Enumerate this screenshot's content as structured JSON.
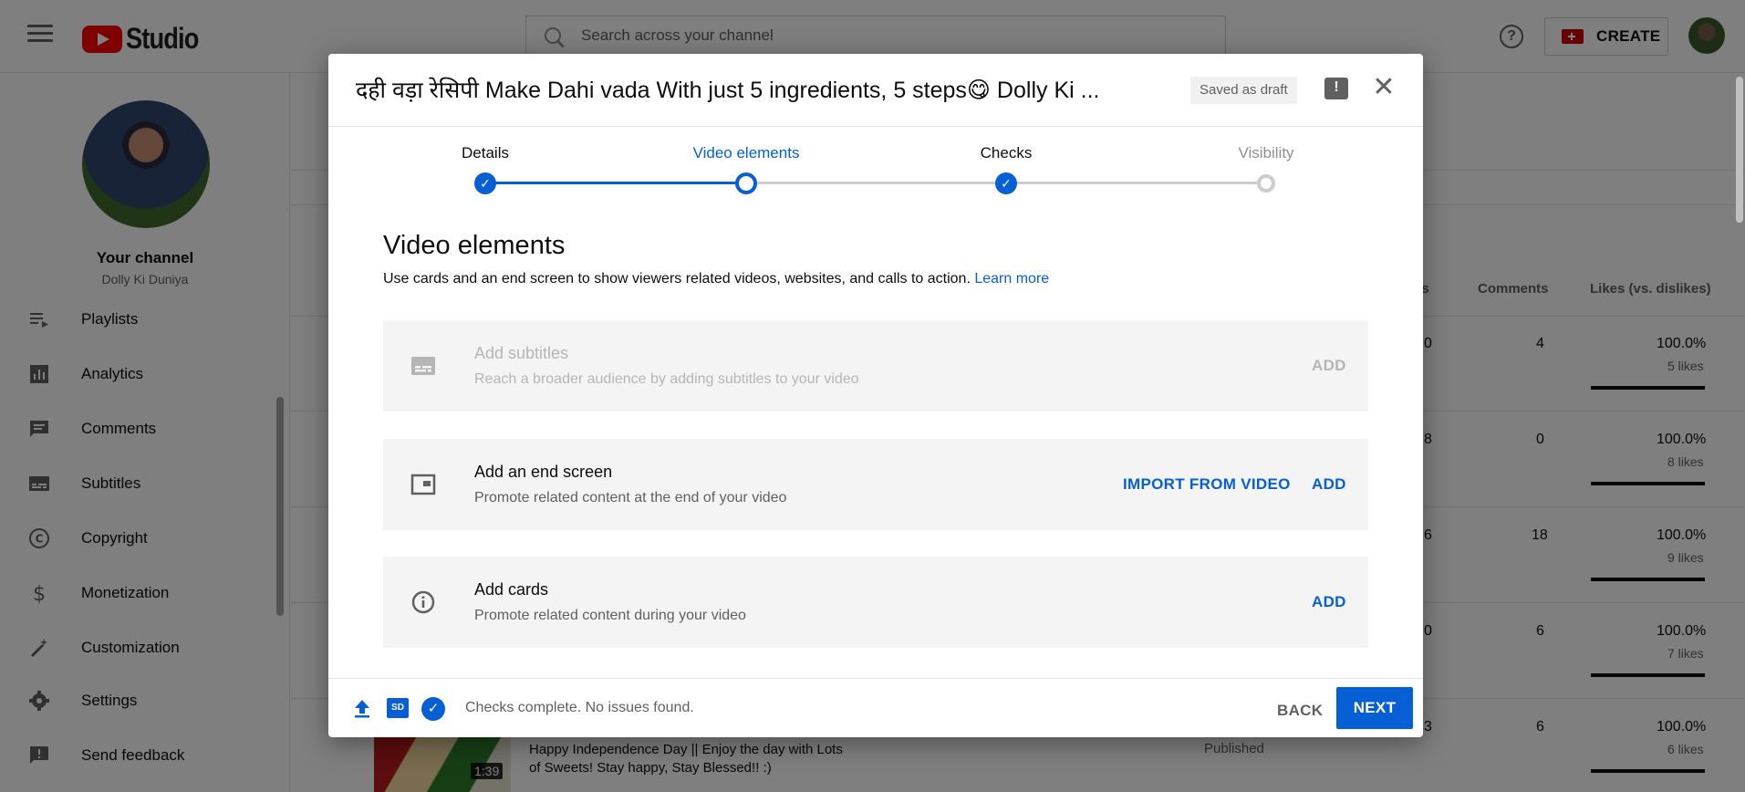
{
  "app": {
    "title": "Studio"
  },
  "search": {
    "placeholder": "Search across your channel"
  },
  "header": {
    "create_label": "CREATE"
  },
  "sidebar": {
    "your_channel": "Your channel",
    "channel_name": "Dolly Ki Duniya",
    "items": [
      {
        "label": "Playlists",
        "icon": "playlists-icon"
      },
      {
        "label": "Analytics",
        "icon": "analytics-icon"
      },
      {
        "label": "Comments",
        "icon": "comments-icon"
      },
      {
        "label": "Subtitles",
        "icon": "subtitles-icon"
      },
      {
        "label": "Copyright",
        "icon": "copyright-icon"
      },
      {
        "label": "Monetization",
        "icon": "monetization-icon"
      },
      {
        "label": "Customization",
        "icon": "customization-icon"
      },
      {
        "label": "Settings",
        "icon": "settings-icon"
      },
      {
        "label": "Send feedback",
        "icon": "feedback-icon"
      }
    ]
  },
  "background_table": {
    "headers": {
      "views_partial": "es",
      "comments": "Comments",
      "likes": "Likes (vs. dislikes)"
    },
    "rows": [
      {
        "views_partial": "0",
        "comments": "4",
        "likes_pct": "100.0%",
        "likes": "5 likes"
      },
      {
        "views_partial": "8",
        "comments": "0",
        "likes_pct": "100.0%",
        "likes": "8 likes"
      },
      {
        "views_partial": "6",
        "comments": "18",
        "likes_pct": "100.0%",
        "likes": "9 likes"
      },
      {
        "views_partial": "0",
        "comments": "6",
        "likes_pct": "100.0%",
        "likes": "7 likes"
      },
      {
        "views_partial": "3",
        "comments": "6",
        "likes_pct": "100.0%",
        "likes": "6 likes"
      }
    ],
    "last_video": {
      "title": "Happy Independence Day || Enjoy the day with Lots of Sweets! Stay happy, Stay Blessed!! :)",
      "duration": "1:39",
      "status": "Published"
    }
  },
  "dialog": {
    "title": "दही वड़ा रेसिपी Make Dahi vada With just 5 ingredients, 5 steps😋 Dolly Ki ...",
    "saved_status": "Saved as draft",
    "steps": [
      {
        "label": "Details",
        "state": "done"
      },
      {
        "label": "Video elements",
        "state": "current"
      },
      {
        "label": "Checks",
        "state": "done"
      },
      {
        "label": "Visibility",
        "state": "pending"
      }
    ],
    "section_title": "Video elements",
    "section_desc": "Use cards and an end screen to show viewers related videos, websites, and calls to action. ",
    "learn_more": "Learn more",
    "cards": [
      {
        "title": "Add subtitles",
        "subtitle": "Reach a broader audience by adding subtitles to your video",
        "action": "ADD",
        "disabled": true
      },
      {
        "title": "Add an end screen",
        "subtitle": "Promote related content at the end of your video",
        "secondary_action": "IMPORT FROM VIDEO",
        "action": "ADD"
      },
      {
        "title": "Add cards",
        "subtitle": "Promote related content during your video",
        "action": "ADD"
      }
    ],
    "footer": {
      "sd_badge": "SD",
      "status": "Checks complete. No issues found.",
      "back": "BACK",
      "next": "NEXT"
    }
  },
  "colors": {
    "accent": "#065fd4",
    "brand_red": "#ff0000",
    "overlay": "rgba(0,0,0,0.5)"
  }
}
